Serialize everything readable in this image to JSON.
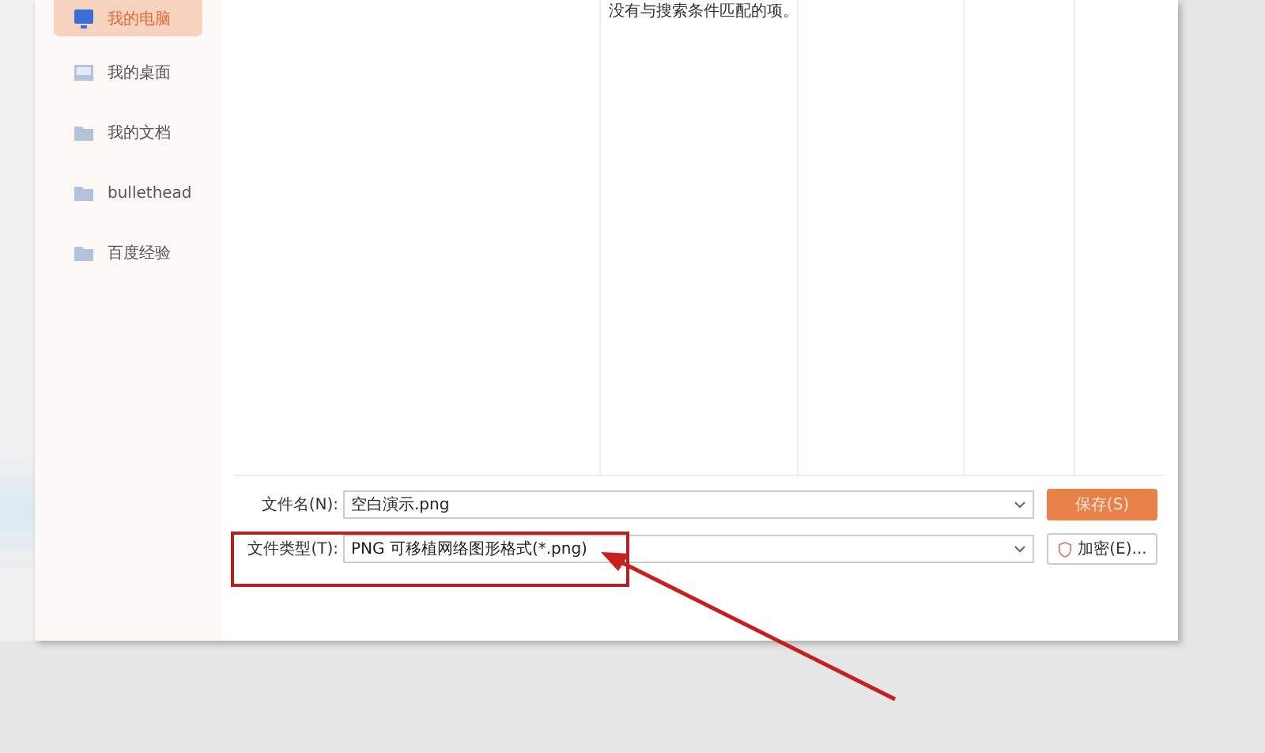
{
  "sidebar": {
    "items": [
      {
        "label": "我的电脑",
        "kind": "computer",
        "selected": true
      },
      {
        "label": "我的桌面",
        "kind": "desktop",
        "selected": false
      },
      {
        "label": "我的文档",
        "kind": "folder",
        "selected": false
      },
      {
        "label": "bullethead",
        "kind": "folder",
        "selected": false
      },
      {
        "label": "百度经验",
        "kind": "folder",
        "selected": false
      }
    ]
  },
  "file_list": {
    "message": "没有与搜索条件匹配的项。"
  },
  "filename": {
    "label": "文件名(N):",
    "value": "空白演示.png"
  },
  "filetype": {
    "label": "文件类型(T):",
    "value": "PNG 可移植网络图形格式(*.png)"
  },
  "buttons": [
    {
      "label": "保存(S)",
      "kind": "primary"
    },
    {
      "label": "加密(E)...",
      "kind": "encrypt"
    }
  ]
}
